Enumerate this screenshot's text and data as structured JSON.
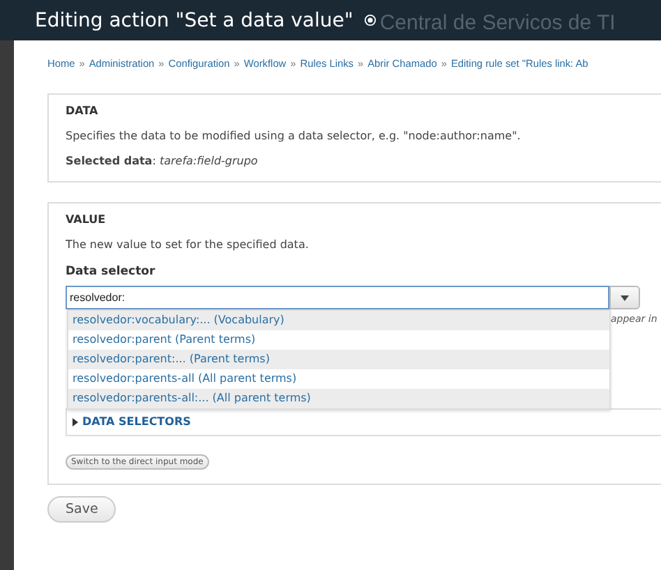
{
  "header": {
    "title": "Editing action \"Set a data value\"",
    "site_name": "Central de Servicos de TI"
  },
  "breadcrumb_separator": "»",
  "breadcrumb": [
    "Home",
    "Administration",
    "Configuration",
    "Workflow",
    "Rules Links",
    "Abrir Chamado",
    "Editing rule set \"Rules link: Ab"
  ],
  "data_section": {
    "legend": "DATA",
    "description": "Specifies the data to be modified using a data selector, e.g. \"node:author:name\".",
    "selected_data": "**Selected data**: *tarefa:field-grupo*"
  },
  "value_section": {
    "legend": "VALUE",
    "description": "The new value to set for the specified data.",
    "field_label": "Data selector",
    "field_value": "resolvedor:",
    "field_hint": "appear in",
    "suggestions": [
      {
        "text": "resolvedor:vocabulary:... (Vocabulary)",
        "selected": true
      },
      {
        "text": "resolvedor:parent (Parent terms)",
        "selected": false
      },
      {
        "text": "resolvedor:parent:... (Parent terms)",
        "selected": true
      },
      {
        "text": "resolvedor:parents-all (All parent terms)",
        "selected": false
      },
      {
        "text": "resolvedor:parents-all:... (All parent terms)",
        "selected": true
      }
    ],
    "selectors_legend": "DATA SELECTORS",
    "selectors_expanded": false,
    "switch_button": "Switch to the direct input mode"
  },
  "save_button": "Save"
}
